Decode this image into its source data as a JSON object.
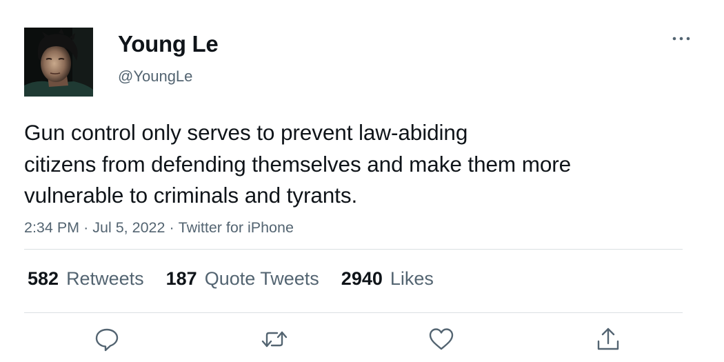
{
  "author": {
    "display_name": "Young Le",
    "handle": "@YoungLe"
  },
  "tweet": {
    "text_lines": [
      "Gun control only serves to prevent law-abiding",
      "citizens from defending themselves and make them more",
      "vulnerable to criminals and tyrants."
    ],
    "time": "2:34 PM",
    "date": "Jul 5, 2022",
    "source": "Twitter for iPhone",
    "separator": "·"
  },
  "stats": {
    "retweets": {
      "count": "582",
      "label": "Retweets"
    },
    "quote_tweets": {
      "count": "187",
      "label": "Quote Tweets"
    },
    "likes": {
      "count": "2940",
      "label": "Likes"
    }
  },
  "actions": {
    "icons": [
      "reply-icon",
      "retweet-icon",
      "like-icon",
      "share-icon"
    ]
  },
  "colors": {
    "text": "#0f1419",
    "secondary": "#536471",
    "divider": "#dadfe2",
    "background": "#ffffff"
  }
}
